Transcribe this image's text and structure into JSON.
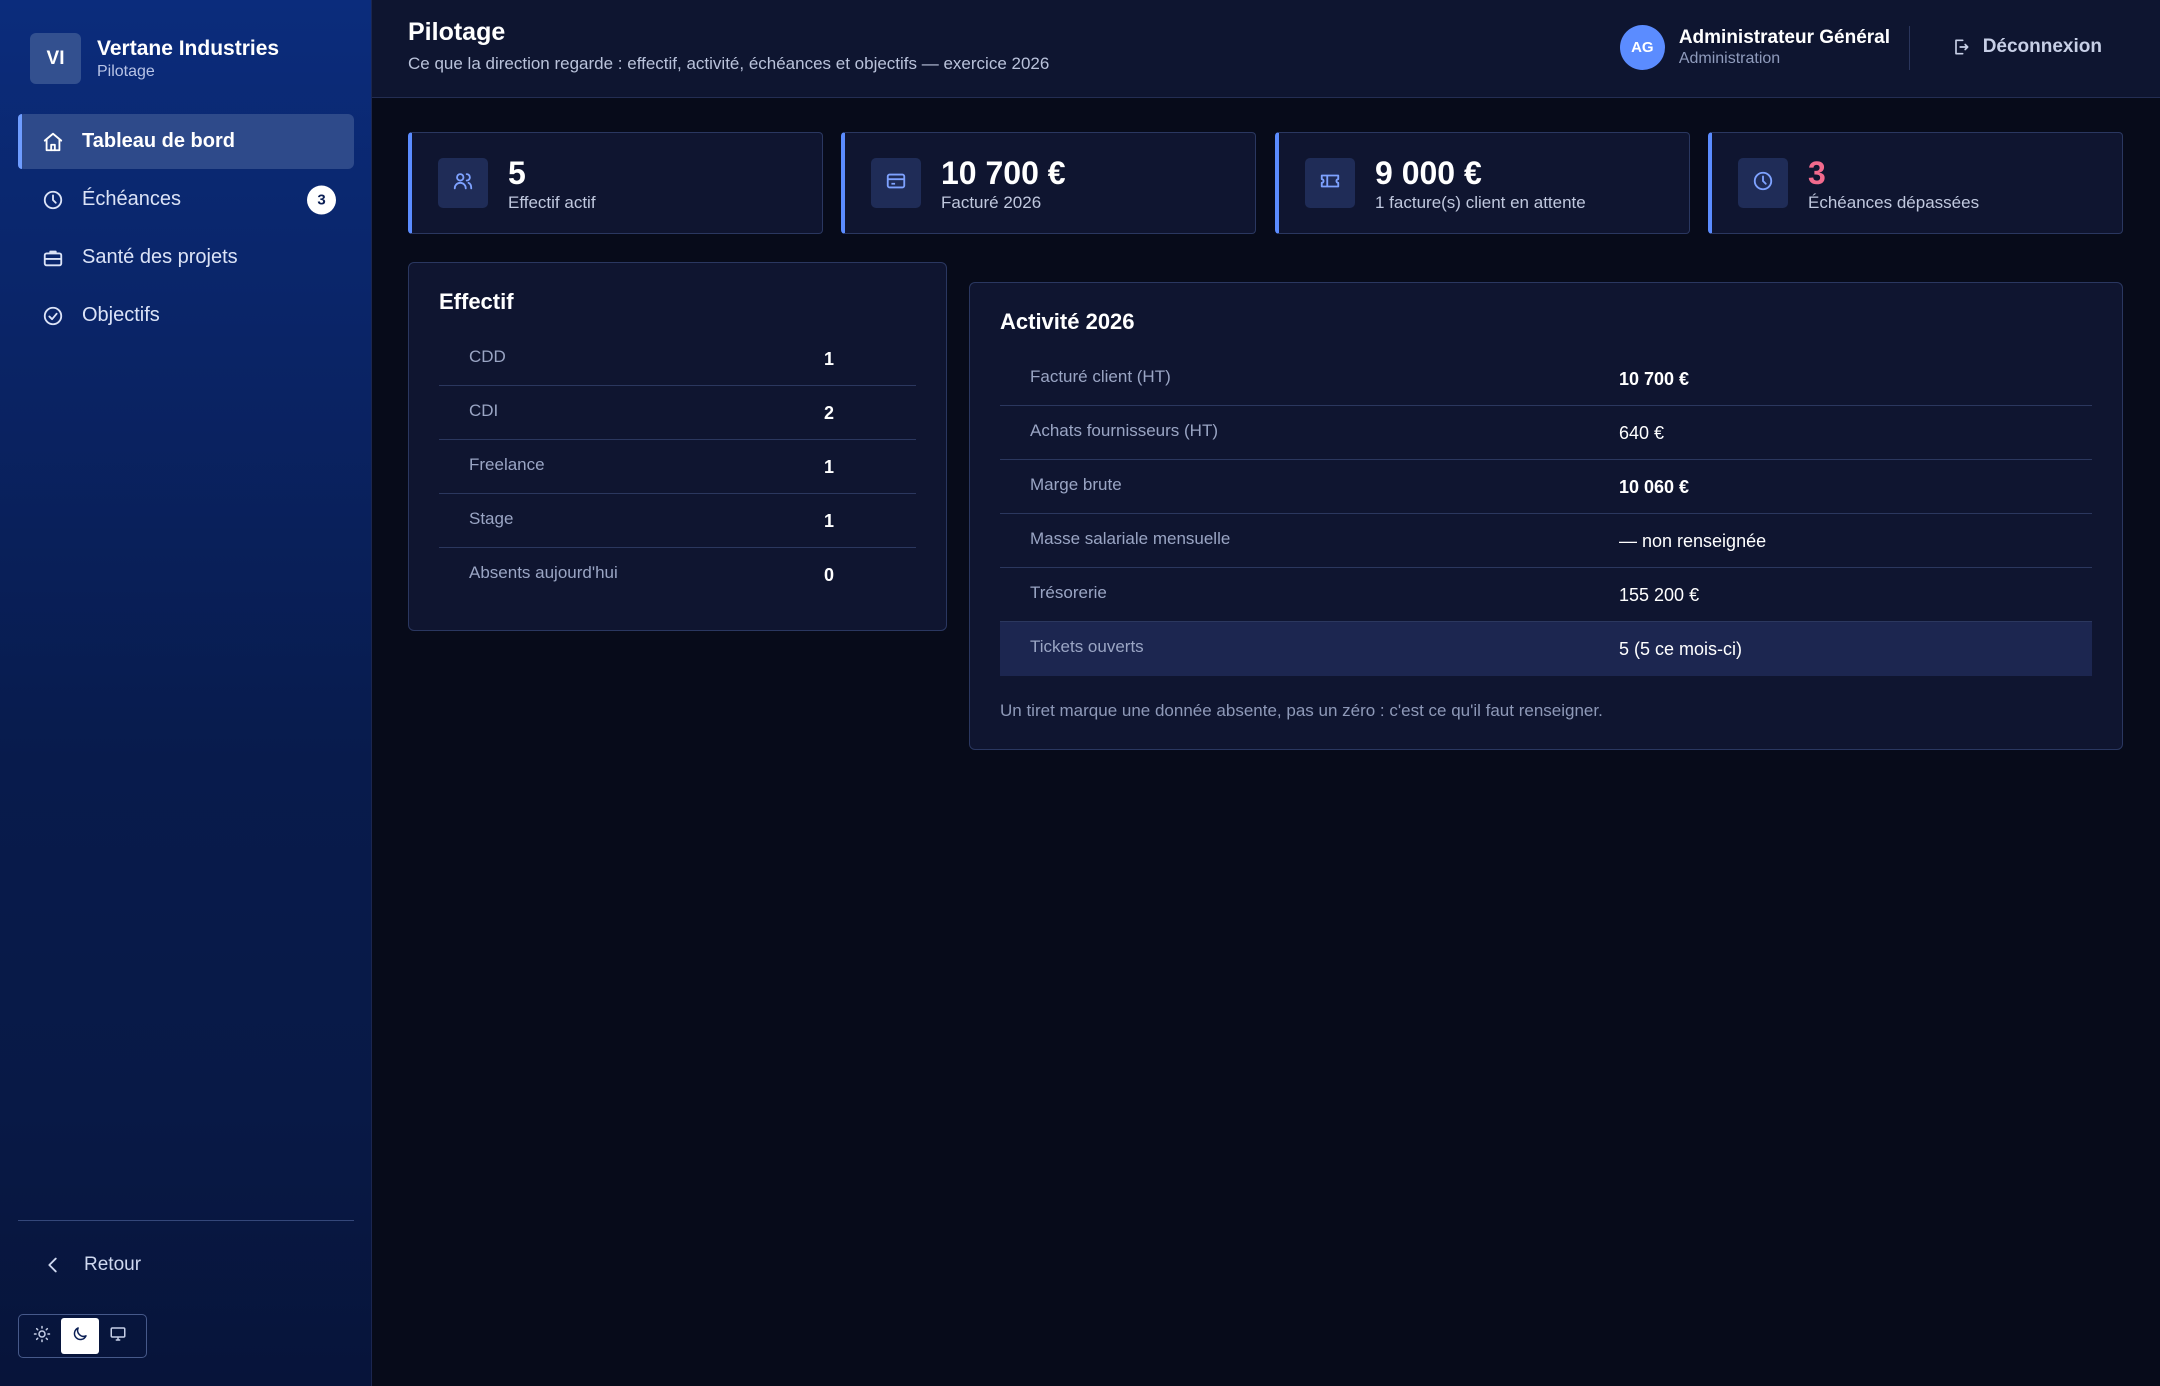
{
  "brand": {
    "initials": "VI",
    "name": "Vertane Industries",
    "subtitle": "Pilotage"
  },
  "nav": {
    "items": [
      {
        "label": "Tableau de bord",
        "icon": "home-icon",
        "active": true
      },
      {
        "label": "Échéances",
        "icon": "clock-icon",
        "badge": "3"
      },
      {
        "label": "Santé des projets",
        "icon": "briefcase-icon"
      },
      {
        "label": "Objectifs",
        "icon": "check-circle-icon"
      }
    ],
    "back_label": "Retour"
  },
  "theme": {
    "options": [
      "sun-icon",
      "moon-icon",
      "monitor-icon"
    ],
    "selected": "moon-icon"
  },
  "header": {
    "title": "Pilotage",
    "subtitle": "Ce que la direction regarde : effectif, activité, échéances et objectifs — exercice 2026",
    "user": {
      "initials": "AG",
      "name": "Administrateur Général",
      "role": "Administration"
    },
    "logout_label": "Déconnexion"
  },
  "kpis": [
    {
      "value": "5",
      "label": "Effectif actif",
      "icon": "users-icon"
    },
    {
      "value": "10 700 €",
      "label": "Facturé 2026",
      "icon": "credit-card-icon"
    },
    {
      "value": "9 000 €",
      "label": "1 facture(s) client en attente",
      "icon": "ticket-icon"
    },
    {
      "value": "3",
      "label": "Échéances dépassées",
      "icon": "clock-icon",
      "alert": true
    }
  ],
  "effectif": {
    "title": "Effectif",
    "rows": [
      {
        "label": "CDD",
        "value": "1"
      },
      {
        "label": "CDI",
        "value": "2"
      },
      {
        "label": "Freelance",
        "value": "1"
      },
      {
        "label": "Stage",
        "value": "1"
      },
      {
        "label": "Absents aujourd'hui",
        "value": "0"
      }
    ]
  },
  "activite": {
    "title": "Activité 2026",
    "rows": [
      {
        "label": "Facturé client (HT)",
        "value": "10 700 €"
      },
      {
        "label": "Achats fournisseurs (HT)",
        "value": "640 €"
      },
      {
        "label": "Marge brute",
        "value": "10 060 €"
      },
      {
        "label": "Masse salariale mensuelle",
        "value": "— non renseignée"
      },
      {
        "label": "Trésorerie",
        "value": "155 200 €"
      },
      {
        "label": "Tickets ouverts",
        "value": "5 (5 ce mois-ci)"
      }
    ],
    "note": "Un tiret marque une donnée absente, pas un zéro : c'est ce qu'il faut renseigner."
  },
  "colors": {
    "accent": "#5b8cff",
    "alert": "#f26a8d",
    "background": "#070b1a",
    "sidebar": "#0a2466"
  }
}
